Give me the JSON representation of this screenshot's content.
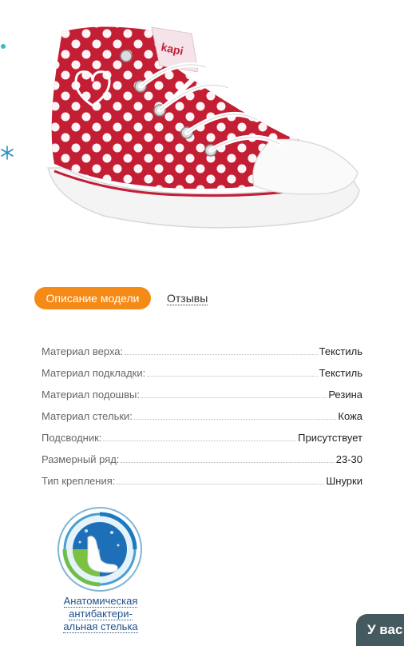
{
  "product": {
    "image_alt": "Красный высокий кед в белый горошек",
    "brand_on_tag": "kapika"
  },
  "tabs": [
    {
      "label": "Описание модели",
      "active": true
    },
    {
      "label": "Отзывы",
      "active": false
    }
  ],
  "specs": [
    {
      "label": "Материал верха:",
      "value": "Текстиль"
    },
    {
      "label": "Материал подкладки:",
      "value": "Текстиль"
    },
    {
      "label": "Материал подошвы:",
      "value": "Резина"
    },
    {
      "label": "Материал стельки:",
      "value": "Кожа"
    },
    {
      "label": "Подсводник:",
      "value": "Присутствует"
    },
    {
      "label": "Размерный ряд:",
      "value": "23-30"
    },
    {
      "label": "Тип крепления:",
      "value": "Шнурки"
    }
  ],
  "feature_badge": {
    "caption_lines": [
      "Анатомическая",
      "антибактери-",
      "альная стелька"
    ],
    "icon": "foot-insole-icon"
  },
  "corner_tab": {
    "label": "У вас"
  },
  "colors": {
    "accent_orange": "#f58a16",
    "shoe_red": "#c41e35",
    "link_blue": "#1f4f8a",
    "corner_tab_bg": "#455a5e"
  }
}
